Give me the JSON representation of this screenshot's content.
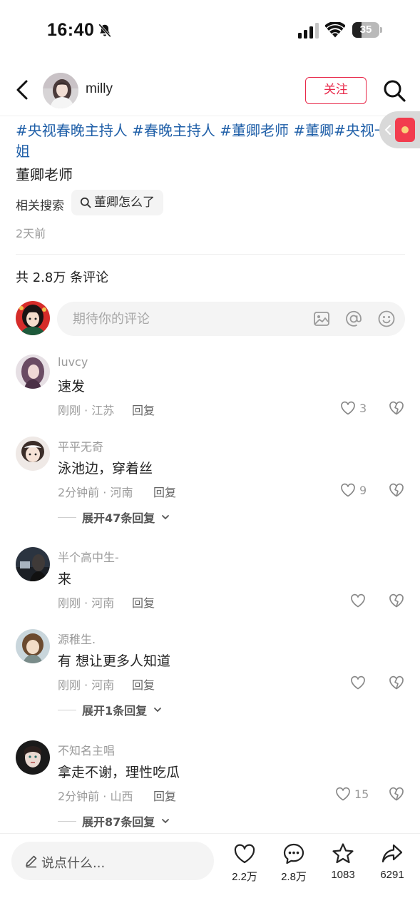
{
  "status_bar": {
    "time": "16:40",
    "battery": "35",
    "battery_level": 0.35
  },
  "header": {
    "author_name": "milly",
    "follow_label": "关注"
  },
  "post": {
    "tags": [
      "#央视春晚主持人",
      "#春晚主持人",
      "#董卿老师",
      "#董卿",
      "#央视一姐"
    ],
    "text": "董卿老师",
    "related_label": "相关搜索",
    "related_query": "董卿怎么了",
    "time": "2天前"
  },
  "comments_section": {
    "count_label": "共 2.8万 条评论",
    "input_placeholder": "期待你的评论"
  },
  "comments": [
    {
      "user": "luvcy",
      "text": "速发",
      "time": "刚刚",
      "location": "江苏",
      "reply_label": "回复",
      "likes": "3",
      "expand": ""
    },
    {
      "user": "平平无奇",
      "text": "泳池边，穿着丝",
      "time": "2分钟前",
      "location": "河南",
      "reply_label": "回复",
      "likes": "9",
      "expand": "展开47条回复"
    },
    {
      "user": "半个高中生-",
      "text": "来",
      "time": "刚刚",
      "location": "河南",
      "reply_label": "回复",
      "likes": "",
      "expand": ""
    },
    {
      "user": "源稚生.",
      "text": "有 想让更多人知道",
      "time": "刚刚",
      "location": "河南",
      "reply_label": "回复",
      "likes": "",
      "expand": "展开1条回复"
    },
    {
      "user": "不知名主唱",
      "text": "拿走不谢，理性吃瓜",
      "time": "2分钟前",
      "location": "山西",
      "reply_label": "回复",
      "likes": "15",
      "expand": "展开87条回复"
    }
  ],
  "bottom_bar": {
    "input_label": "说点什么...",
    "likes": "2.2万",
    "comments": "2.8万",
    "favorites": "1083",
    "shares": "6291"
  },
  "colors": {
    "accent": "#e8294a",
    "tag_blue": "#1f5fa8",
    "muted": "#9a9a9a"
  },
  "icons": [
    "bell-off-icon",
    "signal-icon",
    "wifi-icon",
    "battery-icon",
    "back-icon",
    "search-icon",
    "red-packet-icon",
    "image-icon",
    "at-icon",
    "emoji-icon",
    "heart-icon",
    "broken-heart-icon",
    "chevron-down-icon",
    "pencil-icon",
    "comment-icon",
    "star-icon",
    "share-icon"
  ]
}
